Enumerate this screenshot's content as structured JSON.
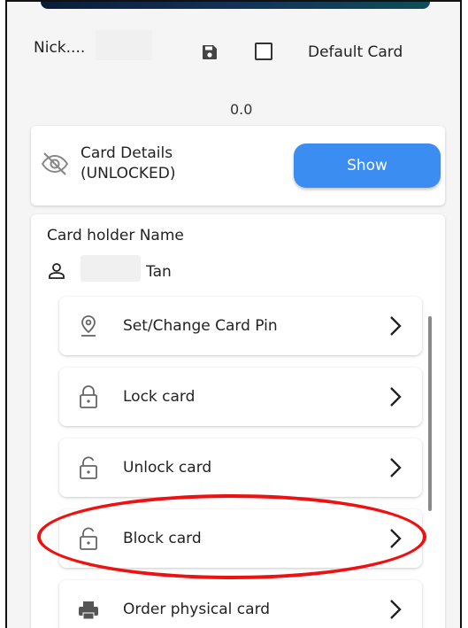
{
  "header": {
    "nickname": "Nick....",
    "default_card_label": "Default Card",
    "default_card_checked": false
  },
  "balance": "0.0",
  "card_details": {
    "title_line1": "Card Details",
    "title_line2": "(UNLOCKED)",
    "show_button": "Show"
  },
  "holder": {
    "label": "Card holder Name",
    "name": "Tan"
  },
  "actions": [
    {
      "label": "Set/Change Card Pin",
      "icon": "location-pin-icon"
    },
    {
      "label": "Lock card",
      "icon": "padlock-icon"
    },
    {
      "label": "Unlock card",
      "icon": "unlock-icon"
    },
    {
      "label": "Block card",
      "icon": "unlock-icon"
    },
    {
      "label": "Order physical card",
      "icon": "printer-icon"
    }
  ],
  "colors": {
    "accent": "#3c8df2",
    "highlight": "#e11111",
    "background": "#f5f5f5"
  }
}
